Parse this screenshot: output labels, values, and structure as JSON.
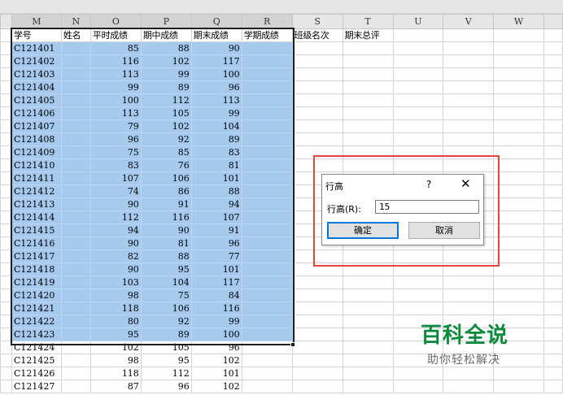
{
  "columns": [
    "M",
    "N",
    "O",
    "P",
    "Q",
    "R",
    "S",
    "T",
    "U",
    "V",
    "W"
  ],
  "headers": [
    "学号",
    "姓名",
    "平时成绩",
    "期中成绩",
    "期末成绩",
    "学期成绩",
    "班级名次",
    "期末总评"
  ],
  "rows": [
    [
      "C121401",
      "",
      "85",
      "88",
      "90"
    ],
    [
      "C121402",
      "",
      "116",
      "102",
      "117"
    ],
    [
      "C121403",
      "",
      "113",
      "99",
      "100"
    ],
    [
      "C121404",
      "",
      "99",
      "89",
      "96"
    ],
    [
      "C121405",
      "",
      "100",
      "112",
      "113"
    ],
    [
      "C121406",
      "",
      "113",
      "105",
      "99"
    ],
    [
      "C121407",
      "",
      "79",
      "102",
      "104"
    ],
    [
      "C121408",
      "",
      "96",
      "92",
      "89"
    ],
    [
      "C121409",
      "",
      "75",
      "85",
      "83"
    ],
    [
      "C121410",
      "",
      "83",
      "76",
      "81"
    ],
    [
      "C121411",
      "",
      "107",
      "106",
      "101"
    ],
    [
      "C121412",
      "",
      "74",
      "86",
      "88"
    ],
    [
      "C121413",
      "",
      "90",
      "91",
      "94"
    ],
    [
      "C121414",
      "",
      "112",
      "116",
      "107"
    ],
    [
      "C121415",
      "",
      "94",
      "90",
      "91"
    ],
    [
      "C121416",
      "",
      "90",
      "81",
      "96"
    ],
    [
      "C121417",
      "",
      "82",
      "88",
      "77"
    ],
    [
      "C121418",
      "",
      "90",
      "95",
      "101"
    ],
    [
      "C121419",
      "",
      "103",
      "104",
      "117"
    ],
    [
      "C121420",
      "",
      "98",
      "75",
      "84"
    ],
    [
      "C121421",
      "",
      "118",
      "106",
      "116"
    ],
    [
      "C121422",
      "",
      "80",
      "92",
      "99"
    ],
    [
      "C121423",
      "",
      "95",
      "89",
      "100"
    ],
    [
      "C121424",
      "",
      "102",
      "105",
      "96"
    ],
    [
      "C121425",
      "",
      "98",
      "95",
      "102"
    ],
    [
      "C121426",
      "",
      "118",
      "112",
      "101"
    ],
    [
      "C121427",
      "",
      "87",
      "96",
      "102"
    ]
  ],
  "dialog": {
    "title": "行高",
    "help": "?",
    "close": "✕",
    "label": "行高(R):",
    "value": "15",
    "ok": "确定",
    "cancel": "取消"
  },
  "watermark": {
    "title": "百科全说",
    "subtitle": "助你轻松解决"
  },
  "colors": {
    "selection": "#a6c9ee",
    "frame": "#e2463c",
    "watermark": "#0b8a3c"
  }
}
